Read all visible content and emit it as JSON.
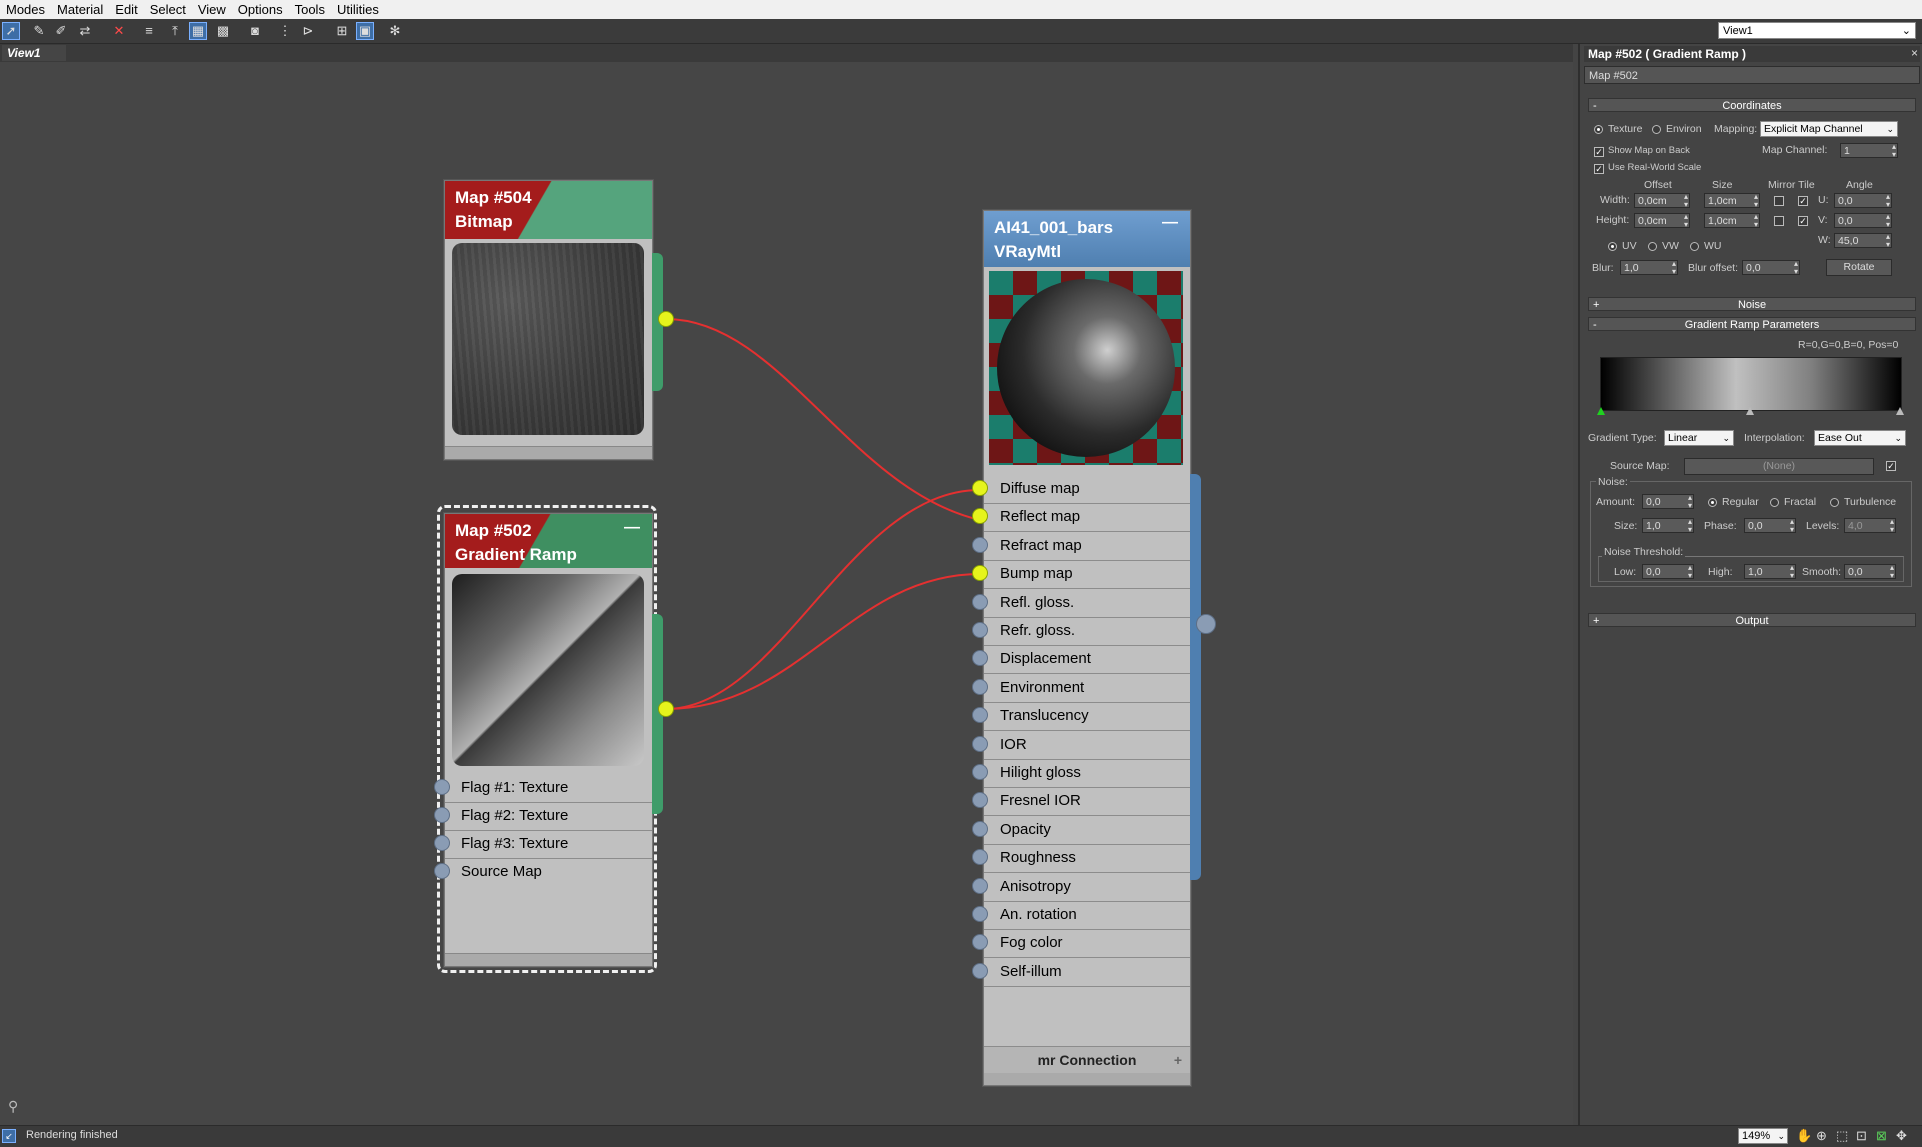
{
  "menu": [
    "Modes",
    "Material",
    "Edit",
    "Select",
    "View",
    "Options",
    "Tools",
    "Utilities"
  ],
  "view_select": {
    "value": "View1"
  },
  "view_tab": "View1",
  "nodes": {
    "bitmap": {
      "title1": "Map #504",
      "title2": "Bitmap"
    },
    "gradient": {
      "title1": "Map #502",
      "title2": "Gradient Ramp",
      "minus": "—",
      "slots": [
        "Flag #1: Texture",
        "Flag #2: Texture",
        "Flag #3: Texture",
        "Source Map"
      ]
    },
    "vray": {
      "title1": "AI41_001_bars",
      "title2": "VRayMtl",
      "minus": "—",
      "slots": [
        {
          "label": "Diffuse map",
          "connected": true
        },
        {
          "label": "Reflect map",
          "connected": true
        },
        {
          "label": "Refract map",
          "connected": false
        },
        {
          "label": "Bump map",
          "connected": true
        },
        {
          "label": "Refl. gloss.",
          "connected": false
        },
        {
          "label": "Refr. gloss.",
          "connected": false
        },
        {
          "label": "Displacement",
          "connected": false
        },
        {
          "label": "Environment",
          "connected": false
        },
        {
          "label": "Translucency",
          "connected": false
        },
        {
          "label": "IOR",
          "connected": false
        },
        {
          "label": "Hilight gloss",
          "connected": false
        },
        {
          "label": "Fresnel IOR",
          "connected": false
        },
        {
          "label": "Opacity",
          "connected": false
        },
        {
          "label": "Roughness",
          "connected": false
        },
        {
          "label": "Anisotropy",
          "connected": false
        },
        {
          "label": "An. rotation",
          "connected": false
        },
        {
          "label": "Fog color",
          "connected": false
        },
        {
          "label": "Self-illum",
          "connected": false
        }
      ],
      "footer": "mr Connection",
      "footer_plus": "+"
    }
  },
  "panel": {
    "title": "Map #502  ( Gradient Ramp )",
    "close": "×",
    "map_name": "Map #502",
    "coordinates": {
      "title": "Coordinates",
      "toggle": "-",
      "texture": "Texture",
      "environ": "Environ",
      "mapping_label": "Mapping:",
      "mapping_value": "Explicit Map Channel",
      "show_map_on_back": "Show Map on Back",
      "map_channel_label": "Map Channel:",
      "map_channel": "1",
      "use_real_world": "Use Real-World Scale",
      "col_offset": "Offset",
      "col_size": "Size",
      "col_mirror_tile": "Mirror Tile",
      "col_angle": "Angle",
      "width_label": "Width:",
      "width_offset": "0,0cm",
      "width_size": "1,0cm",
      "height_label": "Height:",
      "height_offset": "0,0cm",
      "height_size": "1,0cm",
      "u_label": "U:",
      "u_angle": "0,0",
      "v_label": "V:",
      "v_angle": "0,0",
      "w_label": "W:",
      "w_angle": "45,0",
      "uv": "UV",
      "vw": "VW",
      "wu": "WU",
      "blur_label": "Blur:",
      "blur": "1,0",
      "blur_offset_label": "Blur offset:",
      "blur_offset": "0,0",
      "rotate": "Rotate"
    },
    "noise_rollout": {
      "title": "Noise",
      "toggle": "+"
    },
    "gradient": {
      "title": "Gradient Ramp Parameters",
      "toggle": "-",
      "flag_info": "R=0,G=0,B=0, Pos=0",
      "gradient_type_label": "Gradient Type:",
      "gradient_type": "Linear",
      "interpolation_label": "Interpolation:",
      "interpolation": "Ease Out",
      "source_map_label": "Source Map:",
      "source_map": "(None)",
      "noise_label": "Noise:",
      "amount_label": "Amount:",
      "amount": "0,0",
      "regular": "Regular",
      "fractal": "Fractal",
      "turbulence": "Turbulence",
      "size_label": "Size:",
      "size": "1,0",
      "phase_label": "Phase:",
      "phase": "0,0",
      "levels_label": "Levels:",
      "levels": "4,0",
      "threshold_label": "Noise Threshold:",
      "low_label": "Low:",
      "low": "0,0",
      "high_label": "High:",
      "high": "1,0",
      "smooth_label": "Smooth:",
      "smooth": "0,0"
    },
    "output_rollout": {
      "title": "Output",
      "toggle": "+"
    }
  },
  "status": {
    "text": "Rendering finished",
    "zoom": "149%"
  },
  "colors": {
    "wire": "#e53030",
    "socket_on": "#e6f41c",
    "bitmap_header": "#a41c1c",
    "bitmap_header_right": "#55a47d",
    "vray_header": "#5585b8",
    "vray_rail": "#4f7fb0",
    "gradient_rail": "#3f9c6a"
  }
}
